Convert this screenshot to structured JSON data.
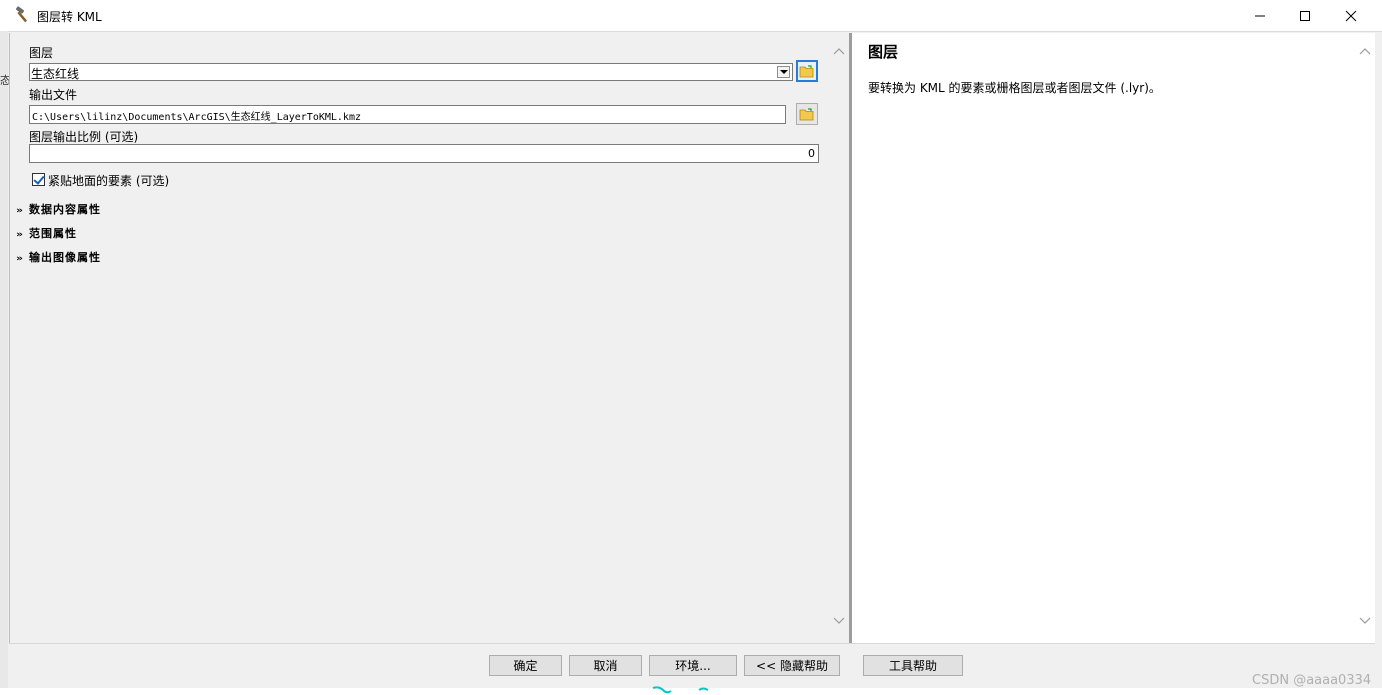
{
  "window": {
    "title": "图层转 KML",
    "icon": "hammer-icon"
  },
  "background_fragment": "态",
  "form": {
    "layer_label": "图层",
    "layer_value": "生态红线",
    "output_label": "输出文件",
    "output_value": "C:\\Users\\lilinz\\Documents\\ArcGIS\\生态红线_LayerToKML.kmz",
    "scale_label": "图层输出比例 (可选)",
    "scale_value": "0",
    "clamp_label": "紧贴地面的要素 (可选)",
    "clamp_checked": true,
    "sections": [
      "数据内容属性",
      "范围属性",
      "输出图像属性"
    ]
  },
  "help": {
    "title": "图层",
    "body": "要转换为 KML 的要素或栅格图层或者图层文件 (.lyr)。"
  },
  "buttons": {
    "ok": "确定",
    "cancel": "取消",
    "env": "环境...",
    "hide_help": "<< 隐藏帮助",
    "tool_help": "工具帮助"
  },
  "watermark": "CSDN @aaaa0334",
  "colors": {
    "accent": "#2a7bd3",
    "teal": "#00c8c8"
  }
}
